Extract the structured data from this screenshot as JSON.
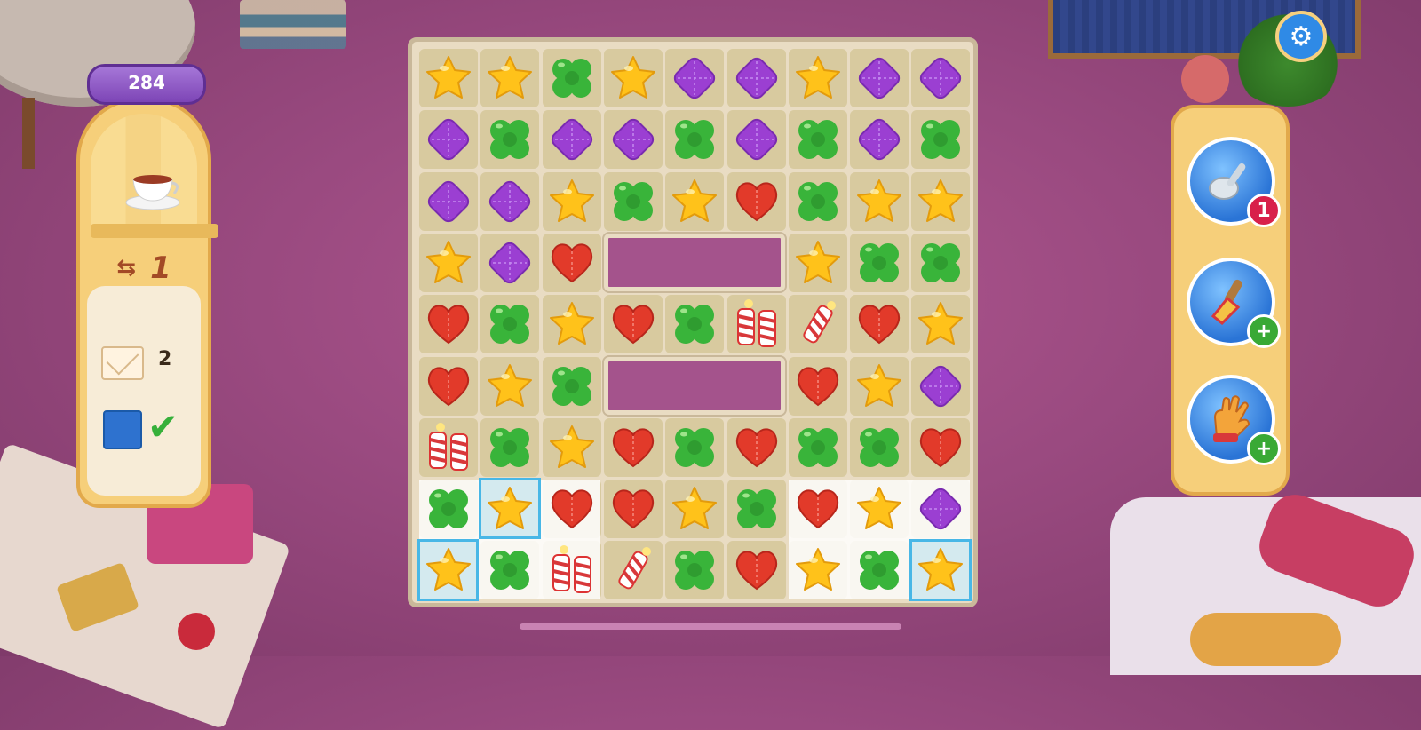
{
  "hud": {
    "score": "284",
    "moves_left": "1",
    "moves_icon": "swap-arrows-icon"
  },
  "goals": [
    {
      "icon": "envelope-icon",
      "count": "2"
    },
    {
      "icon": "blue-tile-icon",
      "status": "complete"
    }
  ],
  "boosters": [
    {
      "name": "spoon-booster",
      "badge": "1",
      "badge_color": "#d8204a"
    },
    {
      "name": "paintbrush-booster",
      "badge": "+",
      "badge_color": "#39a935"
    },
    {
      "name": "glove-booster",
      "badge": "+",
      "badge_color": "#39a935"
    }
  ],
  "colors": {
    "star": "#ffc21a",
    "clover": "#39b43a",
    "diamond": "#9b3fd2",
    "heart": "#e23a2a",
    "blue_tile": "#2e72cf",
    "frame": "#48b7e6"
  },
  "board": {
    "rows": [
      [
        "star",
        "star",
        "clover",
        "star",
        "diamond",
        "diamond",
        "star",
        "diamond",
        "diamond"
      ],
      [
        "diamond",
        "clover",
        "diamond",
        "diamond",
        "clover",
        "diamond",
        "clover",
        "diamond",
        "clover"
      ],
      [
        "diamond",
        "diamond",
        "star",
        "clover",
        "star",
        "heart",
        "clover",
        "star",
        "star"
      ],
      [
        "star",
        "diamond",
        "heart",
        "empty",
        "empty",
        "empty",
        "star",
        "clover",
        "clover"
      ],
      [
        "heart",
        "clover",
        "star",
        "heart",
        "clover",
        "firecracker-double",
        "firecracker",
        "heart",
        "star"
      ],
      [
        "heart",
        "star",
        "clover",
        "empty",
        "empty",
        "empty",
        "heart",
        "star",
        "diamond"
      ],
      [
        "firecracker-double",
        "clover",
        "star",
        "heart",
        "clover",
        "heart",
        "clover",
        "clover",
        "heart"
      ],
      [
        "clover",
        "star",
        "heart",
        "heart",
        "star",
        "clover",
        "heart",
        "star",
        "diamond"
      ],
      [
        "star",
        "clover",
        "firecracker-double",
        "firecracker",
        "clover",
        "heart",
        "star",
        "clover",
        "star"
      ]
    ]
  }
}
